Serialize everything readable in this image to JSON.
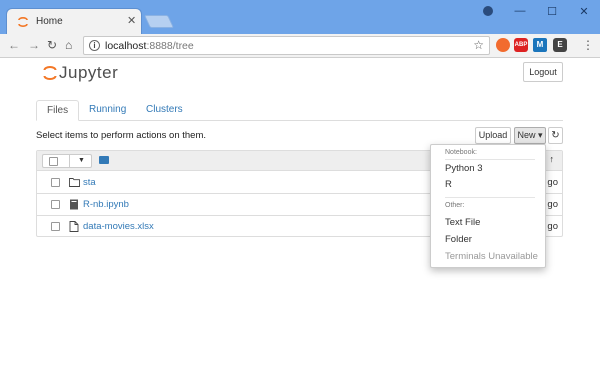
{
  "browser": {
    "tab_title": "Home",
    "tab_close": "✕",
    "url_host": "localhost",
    "url_port_path": ":8888/tree",
    "win_min": "—",
    "win_max": "☐",
    "win_close": "✕",
    "back": "←",
    "forward": "→",
    "reload": "↻",
    "home": "⌂",
    "star": "☆",
    "info": "i",
    "ext_abp": "ABP",
    "ext_m": "M",
    "ext_evernote": "E",
    "menu": "⋮"
  },
  "header": {
    "logo_text": "Jupyter",
    "logout_label": "Logout"
  },
  "tabs": [
    {
      "label": "Files",
      "active": true
    },
    {
      "label": "Running",
      "active": false
    },
    {
      "label": "Clusters",
      "active": false
    }
  ],
  "toolbar": {
    "select_text": "Select items to perform actions on them.",
    "upload_label": "Upload",
    "new_label": "New ▾",
    "refresh_icon": "↻"
  },
  "list": {
    "sort_arrow": "↑",
    "rows": [
      {
        "name": "sta",
        "type": "folder",
        "time": "go"
      },
      {
        "name": "R-nb.ipynb",
        "type": "notebook",
        "time": "go"
      },
      {
        "name": "data-movies.xlsx",
        "type": "file",
        "time": "go"
      }
    ]
  },
  "new_menu": {
    "notebook_header": "Notebook:",
    "notebook_items": [
      "Python 3",
      "R"
    ],
    "other_header": "Other:",
    "other_items": [
      "Text File",
      "Folder"
    ],
    "disabled_item": "Terminals Unavailable"
  },
  "colors": {
    "titlebar": "#6ea4e8",
    "link": "#337ab7",
    "jupyter_orange": "#f37726"
  }
}
